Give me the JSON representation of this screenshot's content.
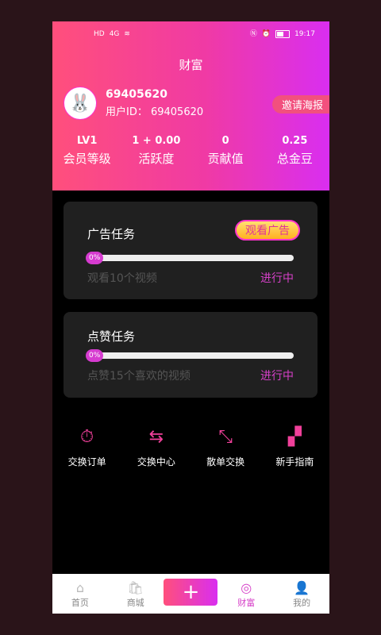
{
  "status_bar": {
    "hd": "HD",
    "signal": "4G",
    "time": "19:17"
  },
  "header": {
    "title": "财富",
    "username": "69405620",
    "user_id": "用户ID： 69405620",
    "invite": "邀请海报"
  },
  "stats": [
    {
      "value": "LV1",
      "label": "会员等级"
    },
    {
      "value": "1 + 0.00",
      "label": "活跃度"
    },
    {
      "value": "0",
      "label": "贡献值"
    },
    {
      "value": "0.25",
      "label": "总金豆"
    }
  ],
  "tasks": [
    {
      "title": "广告任务",
      "button": "观看广告",
      "progress": "0%",
      "desc": "观看10个视频",
      "status": "进行中"
    },
    {
      "title": "点赞任务",
      "progress": "0%",
      "desc": "点赞15个喜欢的视频",
      "status": "进行中"
    }
  ],
  "menu": [
    {
      "label": "交换订单",
      "icon": "clipboard-icon"
    },
    {
      "label": "交换中心",
      "icon": "exchange-icon"
    },
    {
      "label": "散单交换",
      "icon": "resize-icon"
    },
    {
      "label": "新手指南",
      "icon": "map-icon"
    }
  ],
  "tabs": [
    {
      "label": "首页",
      "icon": "home-icon"
    },
    {
      "label": "商城",
      "icon": "shop-icon"
    },
    {
      "label": "+",
      "icon": "plus-icon"
    },
    {
      "label": "财富",
      "icon": "wealth-icon"
    },
    {
      "label": "我的",
      "icon": "user-icon"
    }
  ],
  "colors": {
    "accent": "#d640c8",
    "gradient_start": "#ff4f7c",
    "gradient_end": "#d92ef0"
  }
}
